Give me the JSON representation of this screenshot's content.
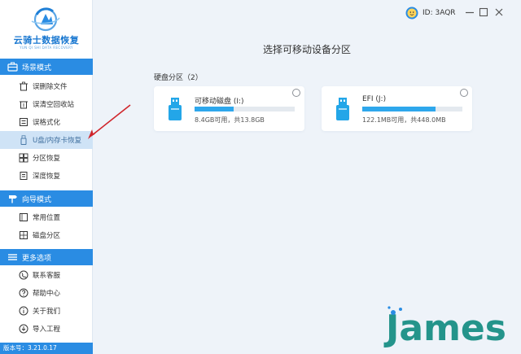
{
  "app": {
    "name": "云骑士数据恢复",
    "tagline": "YUN QI SHI DATA RECOVERY",
    "version": "版本号：3.21.0.17"
  },
  "header": {
    "user_id": "ID: 3AQR"
  },
  "sidebar": {
    "sections": [
      {
        "title": "场景模式",
        "items": [
          {
            "label": "误删除文件",
            "icon": "trash-icon"
          },
          {
            "label": "误清空回收站",
            "icon": "recycle-bin-icon"
          },
          {
            "label": "误格式化",
            "icon": "format-icon"
          },
          {
            "label": "U盘/内存卡恢复",
            "icon": "usb-drive-icon",
            "active": true
          },
          {
            "label": "分区恢复",
            "icon": "partition-icon"
          },
          {
            "label": "深度恢复",
            "icon": "deep-scan-icon"
          }
        ]
      },
      {
        "title": "向导模式",
        "items": [
          {
            "label": "常用位置",
            "icon": "location-icon"
          },
          {
            "label": "磁盘分区",
            "icon": "disk-icon"
          }
        ]
      },
      {
        "title": "更多选项",
        "items": [
          {
            "label": "联系客服",
            "icon": "phone-icon"
          },
          {
            "label": "帮助中心",
            "icon": "help-icon"
          },
          {
            "label": "关于我们",
            "icon": "info-icon"
          },
          {
            "label": "导入工程",
            "icon": "import-icon"
          }
        ]
      }
    ]
  },
  "main": {
    "title": "选择可移动设备分区",
    "section_label": "硬盘分区（2）",
    "drives": [
      {
        "name": "可移动磁盘 (I:)",
        "info": "8.4GB可用，共13.8GB",
        "used_fraction": 0.39
      },
      {
        "name": "EFI (J:)",
        "info": "122.1MB可用，共448.0MB",
        "used_fraction": 0.73
      }
    ]
  },
  "watermark": {
    "text": "James"
  },
  "colors": {
    "accent": "#2a8ce3",
    "bar_fill": "#2ea7ec",
    "active_item_bg": "#cfe3f6",
    "arrow": "#d0252b",
    "watermark": "#1a8f86"
  }
}
